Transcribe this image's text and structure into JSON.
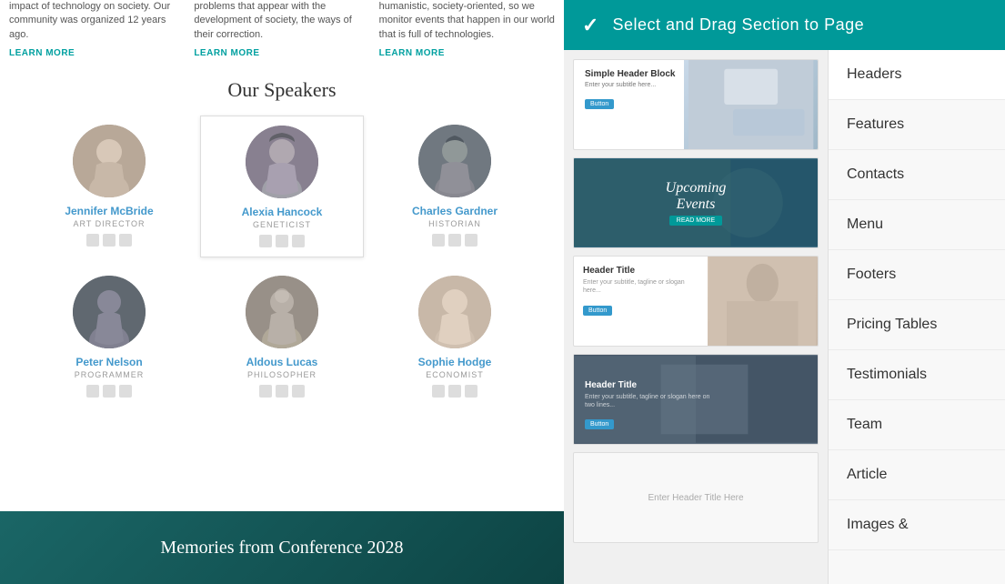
{
  "toolbar": {
    "check_symbol": "✓",
    "title": "Select and  Drag Section to  Page"
  },
  "left_panel": {
    "columns": [
      {
        "text": "impact of technology on society. Our community was organized 12 years ago.",
        "learn_more": "LEARN MORE"
      },
      {
        "text": "problems that appear with the development of society, the ways of their correction.",
        "learn_more": "LEARN MORE"
      },
      {
        "text": "humanistic, society-oriented, so we monitor events that happen in our world that is full of technologies.",
        "learn_more": "LEARN MORE"
      }
    ],
    "speakers_title": "Our Speakers",
    "speakers": [
      {
        "name": "Jennifer McBride",
        "role": "ART DIRECTOR",
        "highlighted": false
      },
      {
        "name": "Alexia Hancock",
        "role": "GENETICIST",
        "highlighted": true
      },
      {
        "name": "Charles Gardner",
        "role": "HISTORIAN",
        "highlighted": false
      },
      {
        "name": "Peter Nelson",
        "role": "PROGRAMMER",
        "highlighted": false
      },
      {
        "name": "Aldous Lucas",
        "role": "PHILOSOPHER",
        "highlighted": false
      },
      {
        "name": "Sophie Hodge",
        "role": "ECONOMIST",
        "highlighted": false
      }
    ],
    "banner_text": "Memories from Conference 2028"
  },
  "thumbnails": [
    {
      "id": "thumb-1",
      "title": "Simple Header Block",
      "subtitle": "Enter your subtitle here..."
    },
    {
      "id": "thumb-2",
      "title": "Upcoming",
      "title2": "Events"
    },
    {
      "id": "thumb-3",
      "title": "Header Title",
      "subtitle": "Enter your subtitle, tagline or slogan here..."
    },
    {
      "id": "thumb-4",
      "title": "Header Title",
      "subtitle": "Enter your subtitle, tagline or slogan here on two lines..."
    },
    {
      "id": "thumb-5",
      "title": "Enter Header Title Here"
    }
  ],
  "nav": {
    "items": [
      {
        "id": "headers",
        "label": "Headers",
        "active": true
      },
      {
        "id": "features",
        "label": "Features"
      },
      {
        "id": "contacts",
        "label": "Contacts"
      },
      {
        "id": "menu",
        "label": "Menu"
      },
      {
        "id": "footers",
        "label": "Footers"
      },
      {
        "id": "pricing-tables",
        "label": "Pricing Tables"
      },
      {
        "id": "testimonials",
        "label": "Testimonials"
      },
      {
        "id": "team",
        "label": "Team"
      },
      {
        "id": "article",
        "label": "Article"
      },
      {
        "id": "images",
        "label": "Images &"
      }
    ]
  }
}
